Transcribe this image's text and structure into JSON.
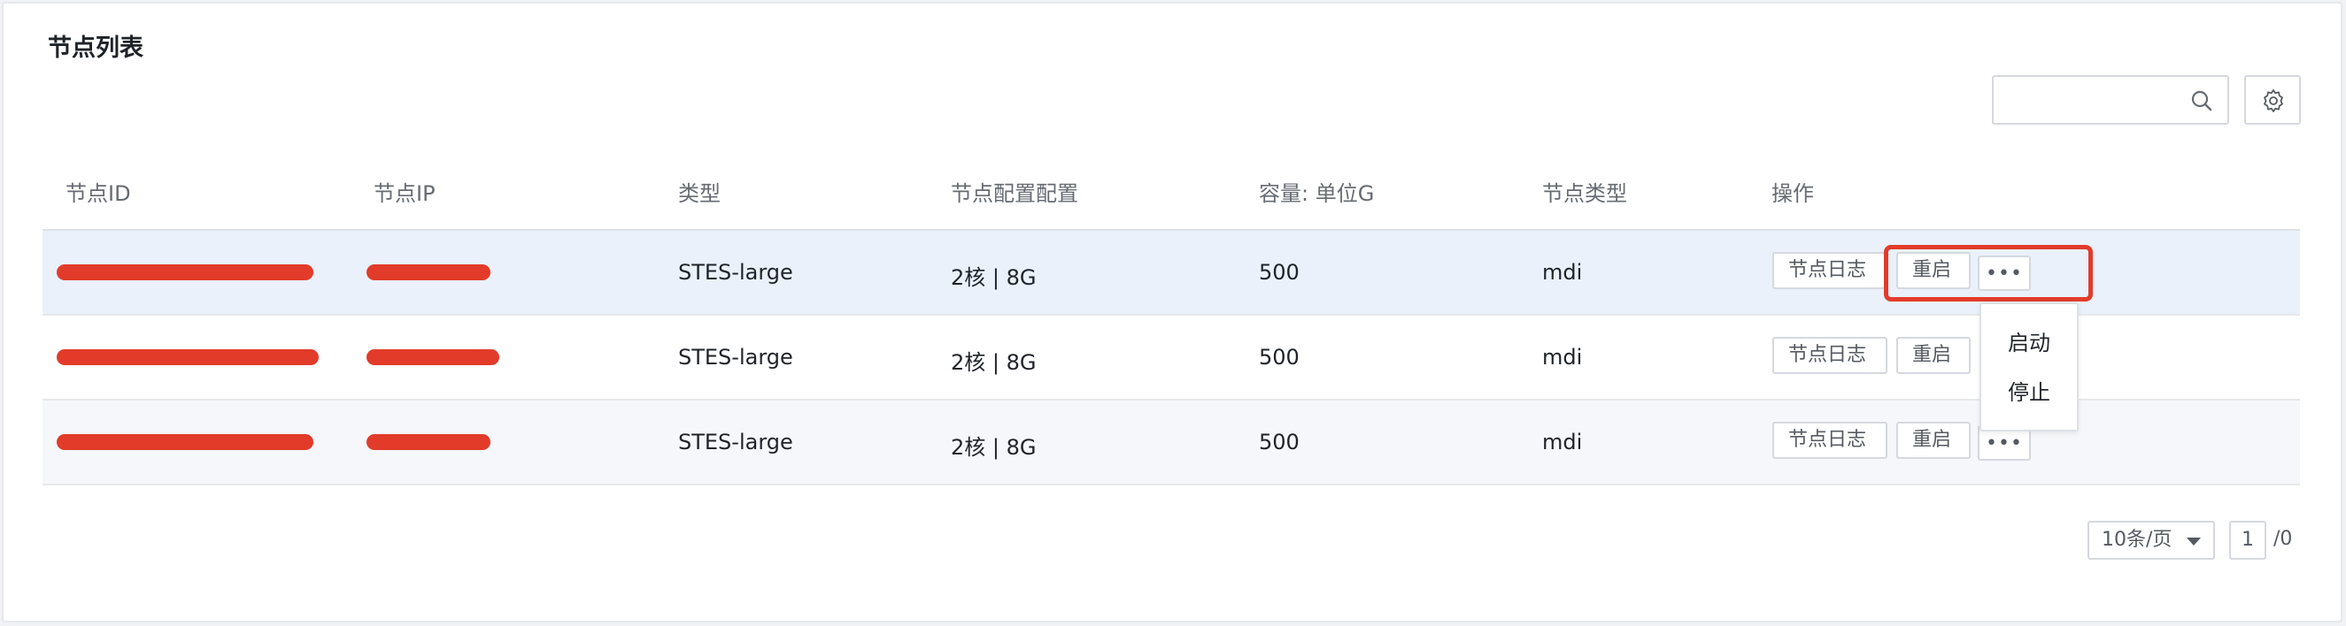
{
  "card": {
    "title": "节点列表"
  },
  "toolbar": {
    "search_placeholder": "",
    "search_icon": "search-icon",
    "settings_icon": "gear-icon"
  },
  "table": {
    "headers": [
      "节点ID",
      "节点IP",
      "类型",
      "节点配置配置",
      "容量: 单位G",
      "节点类型",
      "操作"
    ],
    "rows": [
      {
        "type": "STES-large",
        "config": "2核 | 8G",
        "capacity": "500",
        "node_type": "mdi"
      },
      {
        "type": "STES-large",
        "config": "2核 | 8G",
        "capacity": "500",
        "node_type": "mdi"
      },
      {
        "type": "STES-large",
        "config": "2核 | 8G",
        "capacity": "500",
        "node_type": "mdi"
      }
    ],
    "actions": {
      "log": "节点日志",
      "restart": "重启",
      "more": "•••"
    }
  },
  "dropdown": {
    "items": [
      "启动",
      "停止"
    ]
  },
  "pagination": {
    "page_size": "10条/页",
    "current_page": "1",
    "total": "/0"
  },
  "colors": {
    "highlight": "#e23b2a",
    "row_hover": "#eaf1fb",
    "row_alt": "#f5f7fa"
  }
}
